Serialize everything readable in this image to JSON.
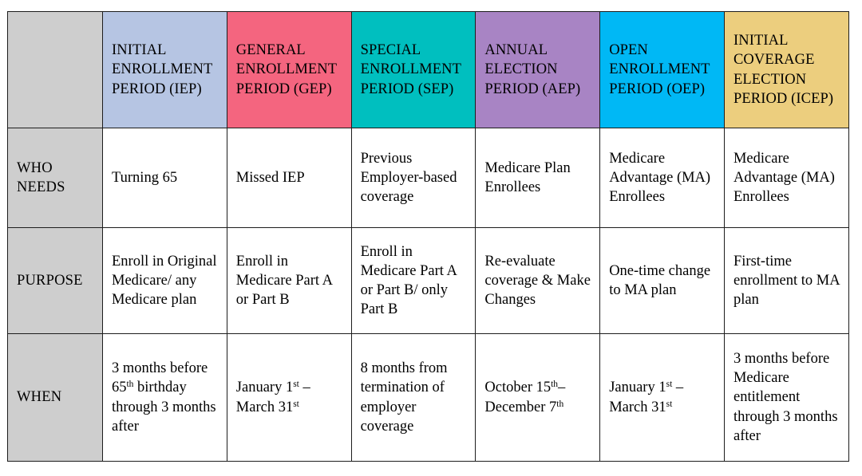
{
  "table": {
    "corner_label": "",
    "columns": [
      {
        "key": "iep",
        "title": "INITIAL ENROLLMENT PERIOD (IEP)",
        "color": "#b6c5e3"
      },
      {
        "key": "gep",
        "title": "GENERAL ENROLLMENT PERIOD (GEP)",
        "color": "#f4657f"
      },
      {
        "key": "sep",
        "title": "SPECIAL ENROLLMENT PERIOD (SEP)",
        "color": "#00bfbf"
      },
      {
        "key": "aep",
        "title": "ANNUAL ELECTION PERIOD (AEP)",
        "color": "#a884c4"
      },
      {
        "key": "oep",
        "title": "OPEN ENROLLMENT PERIOD (OEP)",
        "color": "#00b8f5"
      },
      {
        "key": "icep",
        "title": "INITIAL COVERAGE ELECTION PERIOD (ICEP)",
        "color": "#ecce7e"
      }
    ],
    "rows": [
      {
        "label": "WHO NEEDS",
        "cells": [
          "Turning 65",
          "Missed IEP",
          "Previous Employer-based coverage",
          "Medicare Plan Enrollees",
          "Medicare Advantage (MA) Enrollees",
          "Medicare Advantage (MA) Enrollees"
        ]
      },
      {
        "label": "PURPOSE",
        "cells": [
          "Enroll in Original Medicare/ any Medicare plan",
          "Enroll in Medicare Part A or Part B",
          "Enroll in Medicare Part A or Part B/ only Part B",
          "Re-evaluate coverage & Make Changes",
          "One-time change to MA plan",
          "First-time enrollment to MA plan"
        ]
      },
      {
        "label": "WHEN",
        "cells": [
          "3 months before 65th birthday through 3 months after",
          "January 1st – March 31st",
          "8 months from termination of employer coverage",
          "October 15th–December 7th",
          "January 1st – March 31st",
          "3 months before Medicare entitlement through 3 months after"
        ],
        "cells_html": [
          "3 months before 65<sup>th</sup> birthday through 3 months after",
          "January 1<sup>st</sup> &#8211; March 31<sup>st</sup>",
          "8 months from termination of employer coverage",
          "October 15<sup>th</sup>&#8211;December 7<sup>th</sup>",
          "January 1<sup>st</sup> &#8211; March 31<sup>st</sup>",
          "3 months before Medicare entitlement through 3 months after"
        ]
      }
    ]
  },
  "colors": {
    "row_label_bg": "#cecece",
    "border": "#1d1d1d",
    "page_bg": "#ffffff"
  }
}
